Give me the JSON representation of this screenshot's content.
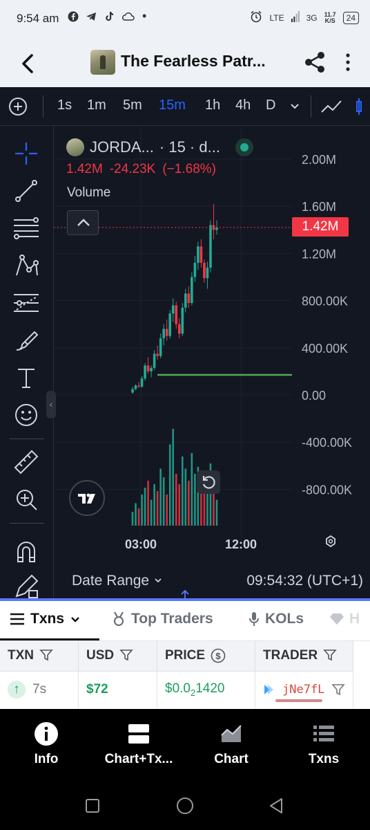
{
  "status_bar": {
    "time": "9:54 am",
    "notifications": [
      "facebook-icon",
      "telegram-icon",
      "tiktok-icon",
      "cloud-icon",
      "dot"
    ],
    "lte": "LTE",
    "net_3g": "3G",
    "speed_value": "11.7",
    "speed_unit": "K/S",
    "battery": "24"
  },
  "header": {
    "title": "The Fearless Patr..."
  },
  "toolbar": {
    "timeframes": [
      "1s",
      "1m",
      "5m",
      "15m",
      "1h",
      "4h",
      "D"
    ],
    "active_timeframe": "15m"
  },
  "legend": {
    "symbol": "JORDA...",
    "interval": "· 15 · d...",
    "last": "1.42M",
    "change": "-24.23K",
    "change_pct": "(−1.68%)",
    "indicator": "Volume"
  },
  "price_badge": "1.42M",
  "chart_data": {
    "type": "candlestick",
    "y_ticks": [
      "2.00M",
      "1.60M",
      "1.20M",
      "800.00K",
      "400.00K",
      "0.00",
      "-400.00K",
      "-800.00K"
    ],
    "x_ticks": [
      "03:00",
      "12:00"
    ],
    "ylim": [
      -1000000,
      2200000
    ],
    "last_price": 1420000,
    "horizontal_line_value": 170000,
    "grid": true,
    "candles": [
      [
        20000,
        70000,
        10000,
        50000
      ],
      [
        50000,
        90000,
        40000,
        80000
      ],
      [
        80000,
        110000,
        60000,
        70000
      ],
      [
        70000,
        160000,
        60000,
        140000
      ],
      [
        140000,
        270000,
        120000,
        250000
      ],
      [
        250000,
        320000,
        180000,
        200000
      ],
      [
        200000,
        250000,
        150000,
        230000
      ],
      [
        230000,
        380000,
        210000,
        350000
      ],
      [
        350000,
        420000,
        300000,
        330000
      ],
      [
        330000,
        520000,
        310000,
        480000
      ],
      [
        480000,
        600000,
        420000,
        560000
      ],
      [
        560000,
        640000,
        460000,
        500000
      ],
      [
        500000,
        720000,
        480000,
        690000
      ],
      [
        690000,
        820000,
        620000,
        760000
      ],
      [
        760000,
        790000,
        560000,
        600000
      ],
      [
        600000,
        650000,
        480000,
        520000
      ],
      [
        520000,
        780000,
        500000,
        740000
      ],
      [
        740000,
        900000,
        700000,
        860000
      ],
      [
        860000,
        920000,
        740000,
        780000
      ],
      [
        780000,
        1040000,
        760000,
        1000000
      ],
      [
        1000000,
        1180000,
        960000,
        1120000
      ],
      [
        1120000,
        1300000,
        1060000,
        1260000
      ],
      [
        1260000,
        1320000,
        1080000,
        1120000
      ],
      [
        1120000,
        1150000,
        950000,
        990000
      ],
      [
        990000,
        1130000,
        900000,
        1080000
      ],
      [
        1080000,
        1480000,
        1040000,
        1440000
      ],
      [
        1440000,
        1620000,
        1320000,
        1400000
      ],
      [
        1400000,
        1480000,
        1360000,
        1420000
      ]
    ],
    "volumes": [
      80,
      130,
      100,
      180,
      220,
      260,
      150,
      240,
      200,
      330,
      280,
      180,
      470,
      560,
      300,
      240,
      400,
      330,
      260,
      420,
      300,
      340,
      260,
      210,
      280,
      360,
      220,
      150
    ]
  },
  "footer": {
    "date_range": "Date Range",
    "clock": "09:54:32 (UTC+1)"
  },
  "tabs": [
    {
      "label": "Txns",
      "active": true
    },
    {
      "label": "Top Traders",
      "active": false
    },
    {
      "label": "KOLs",
      "active": false
    },
    {
      "label": "H",
      "active": false
    }
  ],
  "table": {
    "headers": [
      "TXN",
      "USD",
      "PRICE",
      "TRADER"
    ],
    "rows": [
      {
        "time": "7s",
        "usd": "$72",
        "price_prefix": "$0.0",
        "price_sub": "2",
        "price_suffix": "1420",
        "trader": "jNe7fL"
      }
    ]
  },
  "bottom_nav": [
    {
      "label": "Info",
      "icon": "info-icon"
    },
    {
      "label": "Chart+Tx...",
      "icon": "split-view-icon"
    },
    {
      "label": "Chart",
      "icon": "area-chart-icon"
    },
    {
      "label": "Txns",
      "icon": "list-icon"
    }
  ],
  "colors": {
    "up": "#22ab94",
    "down": "#f23645",
    "active_tf": "#2962ff",
    "hline": "#4caf50"
  }
}
